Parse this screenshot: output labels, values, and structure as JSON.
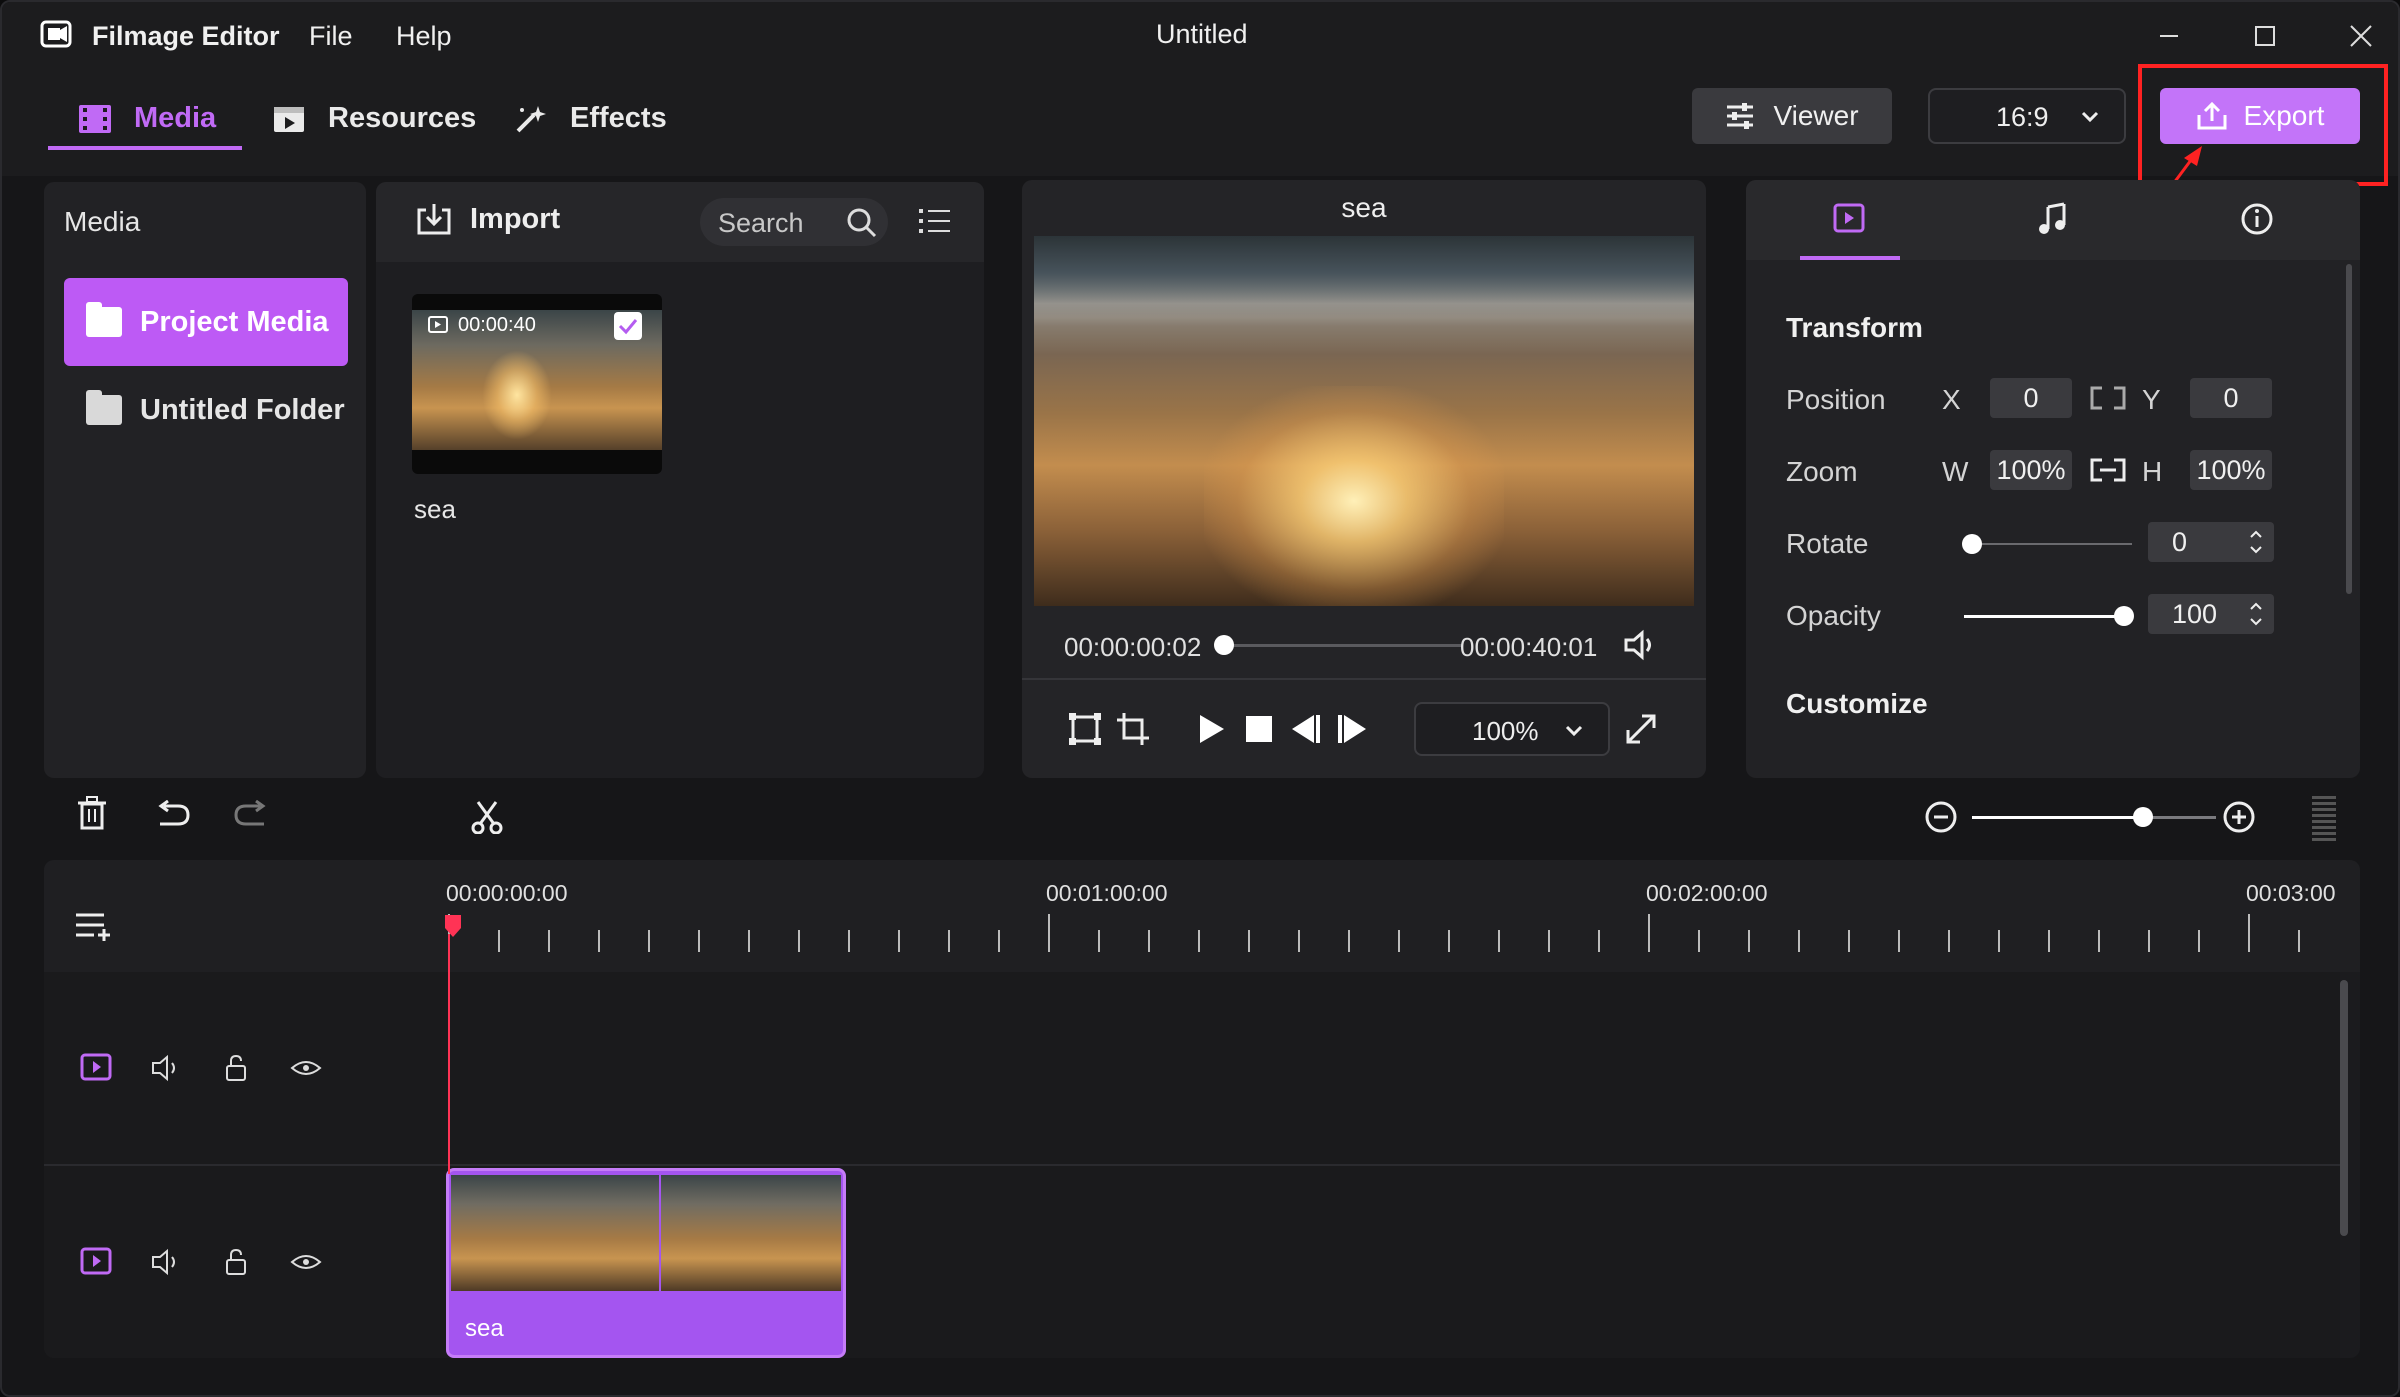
{
  "app": {
    "name": "Filmage Editor",
    "title": "Untitled"
  },
  "menu": {
    "file": "File",
    "help": "Help"
  },
  "nav": {
    "media": "Media",
    "resources": "Resources",
    "effects": "Effects"
  },
  "toolbar": {
    "viewer": "Viewer",
    "ratio": "16:9",
    "export": "Export"
  },
  "sidebar": {
    "title": "Media",
    "items": [
      {
        "label": "Project Media"
      },
      {
        "label": "Untitled Folder"
      }
    ]
  },
  "library": {
    "import": "Import",
    "search_placeholder": "Search",
    "clip": {
      "duration": "00:00:40",
      "name": "sea"
    }
  },
  "preview": {
    "title": "sea",
    "current": "00:00:00:02",
    "total": "00:00:40:01",
    "zoom": "100%",
    "progress": 0.01
  },
  "props": {
    "transform": "Transform",
    "position": {
      "label": "Position",
      "x_label": "X",
      "x": "0",
      "y_label": "Y",
      "y": "0"
    },
    "zoom": {
      "label": "Zoom",
      "w_label": "W",
      "w": "100%",
      "h_label": "H",
      "h": "100%"
    },
    "rotate": {
      "label": "Rotate",
      "value": "0",
      "level": 0
    },
    "opacity": {
      "label": "Opacity",
      "value": "100",
      "level": 1
    },
    "customize": "Customize"
  },
  "timeline": {
    "marks": [
      "00:00:00:00",
      "00:01:00:00",
      "00:02:00:00",
      "00:03:00"
    ],
    "clip_name": "sea",
    "zoom_level": 0.7
  },
  "colors": {
    "accent": "#c374f9",
    "playhead": "#ff3355",
    "highlight": "#ff2222"
  }
}
